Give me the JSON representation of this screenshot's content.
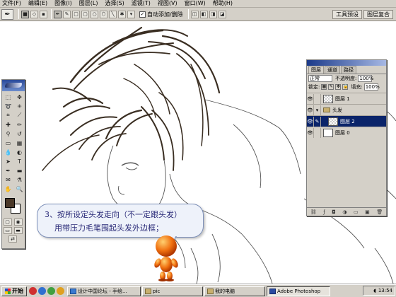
{
  "menubar": {
    "items": [
      "文件(F)",
      "编辑(E)",
      "图像(I)",
      "图层(L)",
      "选择(S)",
      "滤镜(T)",
      "视图(V)",
      "窗口(W)",
      "帮助(H)"
    ]
  },
  "options_bar": {
    "active_tool_icon": "pen-icon",
    "auto_add_delete_label": "自动添加/删除",
    "auto_add_delete_checked": true,
    "palette_tabs": [
      "工具预设",
      "图层复合"
    ]
  },
  "toolbox": {
    "foreground_color": "#4a3828",
    "background_color": "#ffffff"
  },
  "layers_panel": {
    "tabs": [
      "图层",
      "通道",
      "路径"
    ],
    "blend_mode": "正常",
    "opacity_label": "不透明度:",
    "opacity_value": "100%",
    "lock_label": "锁定:",
    "fill_label": "填充:",
    "fill_value": "100%",
    "layers": [
      {
        "name": "图层 1",
        "type": "layer",
        "visible": true,
        "selected": false
      },
      {
        "name": "头发",
        "type": "group",
        "visible": true,
        "selected": false
      },
      {
        "name": "图层 2",
        "type": "layer",
        "visible": true,
        "selected": true
      },
      {
        "name": "图层 0",
        "type": "layer",
        "visible": true,
        "selected": false
      }
    ]
  },
  "callout": {
    "line1": "3、按所设定头发走向（不一定跟头发）",
    "line2": "用带压力毛笔围起头发外边框；"
  },
  "taskbar": {
    "start_label": "开始",
    "tasks": [
      {
        "label": "设计中国论坛 - 手绘...",
        "active": false
      },
      {
        "label": "pic",
        "active": false
      },
      {
        "label": "我的电脑",
        "active": false
      },
      {
        "label": "Adobe Photoshop",
        "active": true
      }
    ],
    "clock": "13:54"
  },
  "colors": {
    "ui_gray": "#d4d0c8",
    "selection_blue": "#0a246a",
    "ink": "#3a2e22",
    "callout_text": "#2a2a78"
  }
}
